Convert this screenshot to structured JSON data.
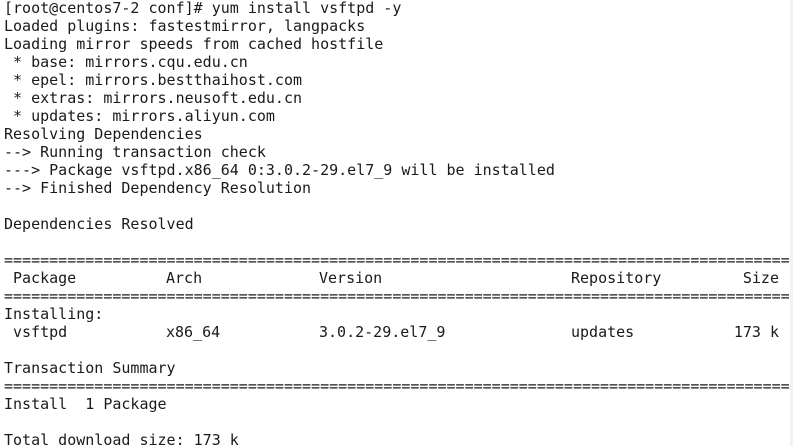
{
  "terminal": {
    "lines": [
      "[root@centos7-2 conf]# yum install vsftpd -y",
      "Loaded plugins: fastestmirror, langpacks",
      "Loading mirror speeds from cached hostfile",
      " * base: mirrors.cqu.edu.cn",
      " * epel: mirrors.bestthaihost.com",
      " * extras: mirrors.neusoft.edu.cn",
      " * updates: mirrors.aliyun.com",
      "Resolving Dependencies",
      "--> Running transaction check",
      "---> Package vsftpd.x86_64 0:3.0.2-29.el7_9 will be installed",
      "--> Finished Dependency Resolution",
      "",
      "Dependencies Resolved",
      ""
    ],
    "separator": "=========================================================================================================",
    "table_header": {
      "package": "Package",
      "arch": "Arch",
      "version": "Version",
      "repository": "Repository",
      "size": "Size"
    },
    "installing_label": "Installing:",
    "table_row": {
      "package": "vsftpd",
      "arch": "x86_64",
      "version": "3.0.2-29.el7_9",
      "repository": "updates",
      "size": "173 k"
    },
    "summary_title": "Transaction Summary",
    "install_count": "Install  1 Package",
    "total_download": "Total download size: 173 k"
  }
}
